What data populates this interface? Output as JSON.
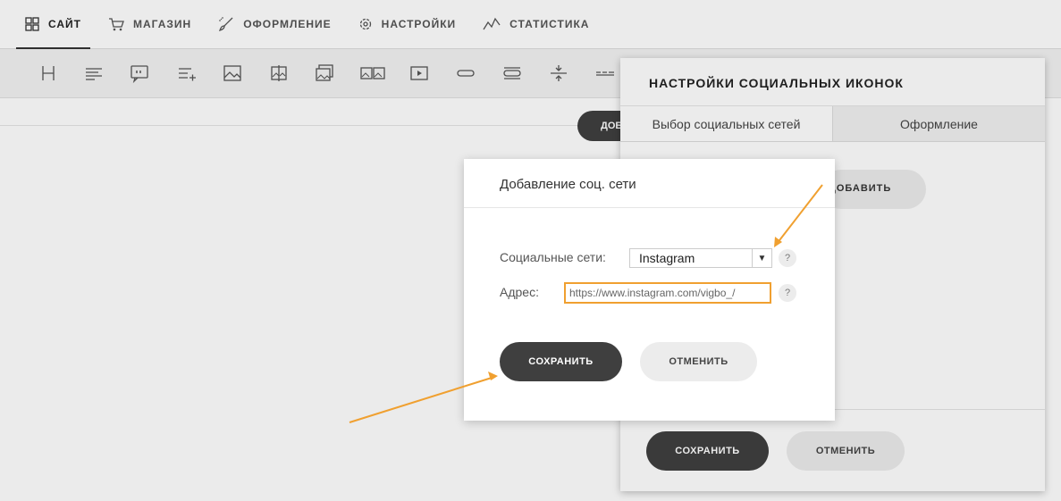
{
  "nav": {
    "items": [
      {
        "label": "САЙТ",
        "icon": "grid-icon",
        "active": true
      },
      {
        "label": "МАГАЗИН",
        "icon": "cart-icon"
      },
      {
        "label": "ОФОРМЛЕНИЕ",
        "icon": "brush-icon"
      },
      {
        "label": "НАСТРОЙКИ",
        "icon": "gear-icon"
      },
      {
        "label": "СТАТИСТИКА",
        "icon": "stats-icon"
      }
    ]
  },
  "canvas": {
    "add_label": "ДОБ"
  },
  "panel": {
    "title": "НАСТРОЙКИ СОЦИАЛЬНЫХ ИКОНОК",
    "tabs": [
      "Выбор социальных сетей",
      "Оформление"
    ],
    "add_button": "ДОБАВИТЬ",
    "save_label": "СОХРАНИТЬ",
    "cancel_label": "ОТМЕНИТЬ"
  },
  "modal": {
    "title": "Добавление соц. сети",
    "social_label": "Социальные сети:",
    "social_value": "Instagram",
    "address_label": "Адрес:",
    "address_value": "https://www.instagram.com/vigbo_/",
    "help": "?",
    "save_label": "СОХРАНИТЬ",
    "cancel_label": "ОТМЕНИТЬ"
  },
  "colors": {
    "accent": "#f0a030",
    "dark_button": "#3f3f3f"
  }
}
